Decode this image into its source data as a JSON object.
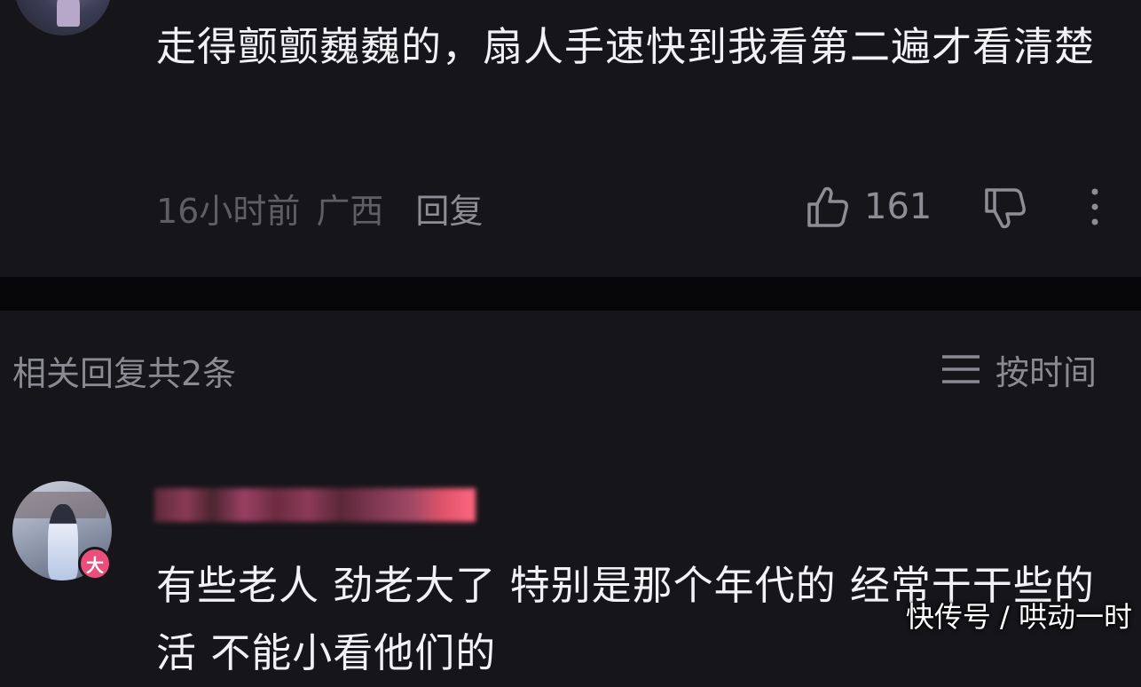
{
  "top_comment": {
    "text": "走得颤颤巍巍的，扇人手速快到我看第二遍才看清楚",
    "time": "16小时前",
    "location": "广西",
    "reply_label": "回复",
    "like_count": "161",
    "icons": [
      "thumbs-up-icon",
      "thumbs-down-icon",
      "more-vertical-icon"
    ]
  },
  "replies": {
    "count_label": "相关回复共2条",
    "sort_label": "按时间",
    "sort_icon": "menu-lines-icon"
  },
  "reply_comment": {
    "badge": "大",
    "text": "有些老人 劲老大了 特别是那个年代的 经常干干些的活 不能小看他们的"
  },
  "watermark": "快传号 / 哄动一时",
  "colors": {
    "background": "#161519",
    "divider": "#060608",
    "text_primary": "#f2f2f4",
    "text_secondary": "#8a8a92",
    "badge": "#ea4e7a"
  }
}
